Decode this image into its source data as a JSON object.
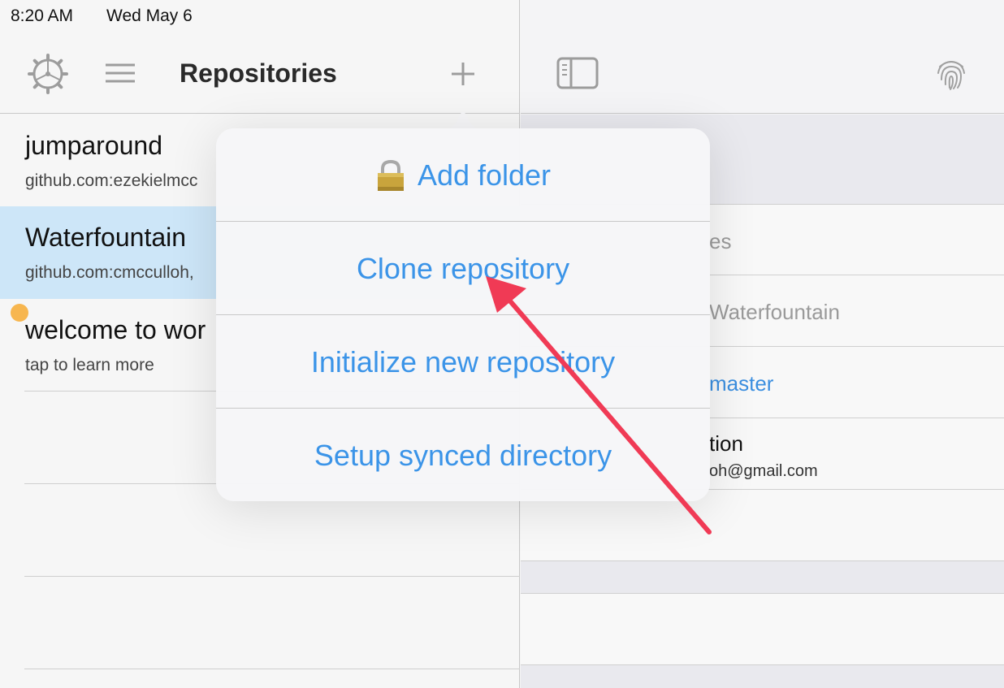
{
  "status_bar": {
    "time": "8:20 AM",
    "date": "Wed May 6"
  },
  "left_nav": {
    "title": "Repositories",
    "icons": [
      "gear-icon",
      "menu-icon",
      "plus-icon"
    ]
  },
  "repos": [
    {
      "name": "jumparound",
      "sub": "github.com:ezekielmcc",
      "selected": false
    },
    {
      "name": "Waterfountain",
      "sub": "github.com:cmcculloh,",
      "selected": true
    },
    {
      "name": "welcome to wor",
      "sub": "tap to learn more",
      "selected": false
    }
  ],
  "right_nav": {
    "icons": [
      "sidebar-icon",
      "fingerprint-icon"
    ]
  },
  "detail": {
    "row1": "es",
    "row2": "Waterfountain",
    "row3": "master",
    "row4_title": "tion",
    "row4_sub": "oh@gmail.com"
  },
  "popover": {
    "items": [
      {
        "label": "Add folder",
        "icon": "lock-icon"
      },
      {
        "label": "Clone repository"
      },
      {
        "label": "Initialize new repository"
      },
      {
        "label": "Setup synced directory"
      }
    ]
  },
  "colors": {
    "accent": "#3b94e8",
    "selected_row": "#cde6f8",
    "annotation_arrow": "#f03a55",
    "badge": "#f7b64f"
  }
}
